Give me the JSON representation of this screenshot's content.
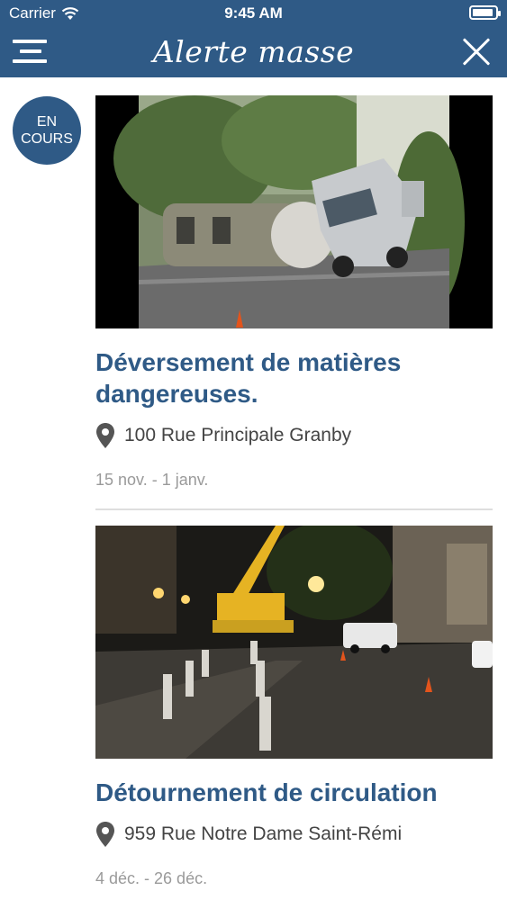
{
  "status_bar": {
    "carrier": "Carrier",
    "time": "9:45 AM",
    "battery_level": 0.9
  },
  "nav": {
    "title": "Alerte masse",
    "menu_icon": "menu-icon",
    "close_icon": "close-icon"
  },
  "badge": {
    "line1": "EN",
    "line2": "COURS"
  },
  "alerts": [
    {
      "title": "Déversement de matières dangereuses.",
      "address": "100 Rue Principale Granby",
      "dates": "15 nov. - 1 janv.",
      "image": "overturned-tanker-truck"
    },
    {
      "title": "Détournement de circulation",
      "address": "959 Rue Notre Dame Saint-Rémi",
      "dates": "4 déc. - 26 déc.",
      "image": "night-roadwork-crane"
    }
  ],
  "colors": {
    "primary": "#2f5a86",
    "muted_text": "#9a9a9a",
    "divider": "#dedede"
  }
}
